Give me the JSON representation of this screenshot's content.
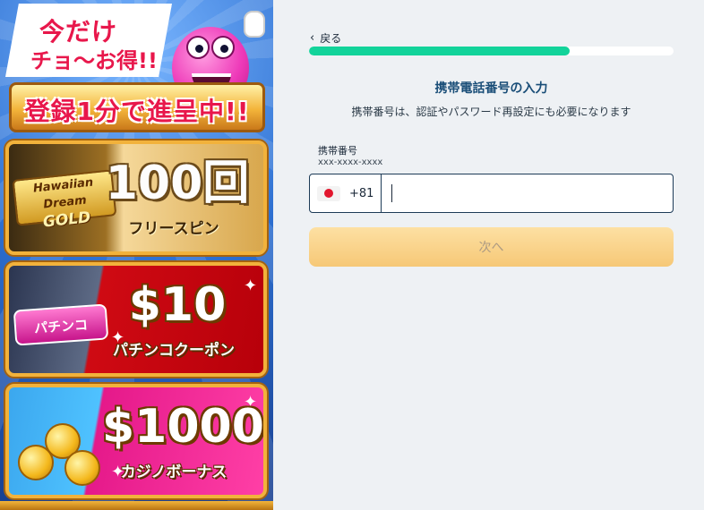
{
  "promo": {
    "flag_line1": "今だけ",
    "flag_line2": "チョ〜お得!!",
    "ribbon": "登録1分で進呈中!!",
    "cards": [
      {
        "game_logo_top": "Hawaiian",
        "game_logo_mid": "Dream",
        "game_logo_big": "GOLD",
        "big": "100回",
        "sub": "フリースピン"
      },
      {
        "game_logo": "パチンコ",
        "big": "$10",
        "sub": "パチンコクーポン"
      },
      {
        "big": "$1000",
        "sub": "カジノボーナス"
      }
    ]
  },
  "form": {
    "back_label": "戻る",
    "progress_fraction": 0.716,
    "title": "携帯電話番号の入力",
    "subtitle": "携帯番号は、認証やパスワード再設定にも必要になります",
    "field_label": "携帯番号",
    "field_hint": "xxx-xxxx-xxxx",
    "country_code": "+81",
    "phone_value": "",
    "next_label": "次へ"
  },
  "colors": {
    "progress": "#12d39a",
    "title": "#1a4e78",
    "button_bg": "#f6c877",
    "button_text": "#ac9a82",
    "background": "#eef1f4"
  },
  "icons": {
    "back": "chevron-left-icon",
    "country": "japan-flag-icon"
  }
}
